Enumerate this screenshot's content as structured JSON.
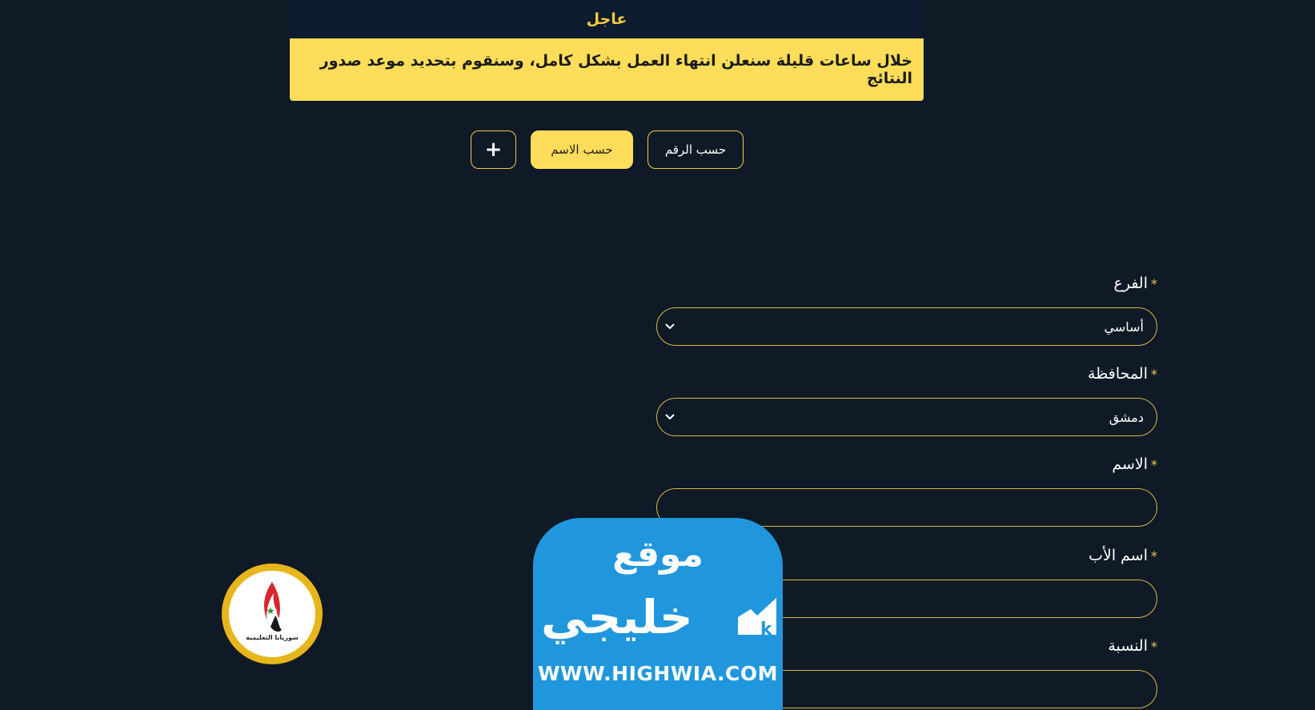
{
  "notice": {
    "title": "عاجل",
    "message": "خلال ساعات قليلة سنعلن انتهاء العمل بشكل كامل، وسنقوم بتحديد موعد صدور النتائج"
  },
  "tabs": {
    "by_number": "حسب الرقم",
    "by_name": "حسب الاسم",
    "add": "+"
  },
  "form": {
    "required_mark": "*",
    "branch": {
      "label": "الفرع",
      "value": "أساسي"
    },
    "governorate": {
      "label": "المحافظة",
      "value": "دمشق"
    },
    "name": {
      "label": "الاسم",
      "value": ""
    },
    "father_name": {
      "label": "اسم الأب",
      "value": ""
    },
    "percentage": {
      "label": "النسبة",
      "value": ""
    }
  },
  "logo": {
    "caption": "سوريانا التعليمية"
  },
  "watermark": {
    "top": "موقع",
    "middle": "خليجي",
    "url": "WWW.HIGHWIA.COM"
  },
  "colors": {
    "background": "#0f1a26",
    "accent": "#fedd5a",
    "border": "#d8b646",
    "watermark": "#2097dc"
  }
}
